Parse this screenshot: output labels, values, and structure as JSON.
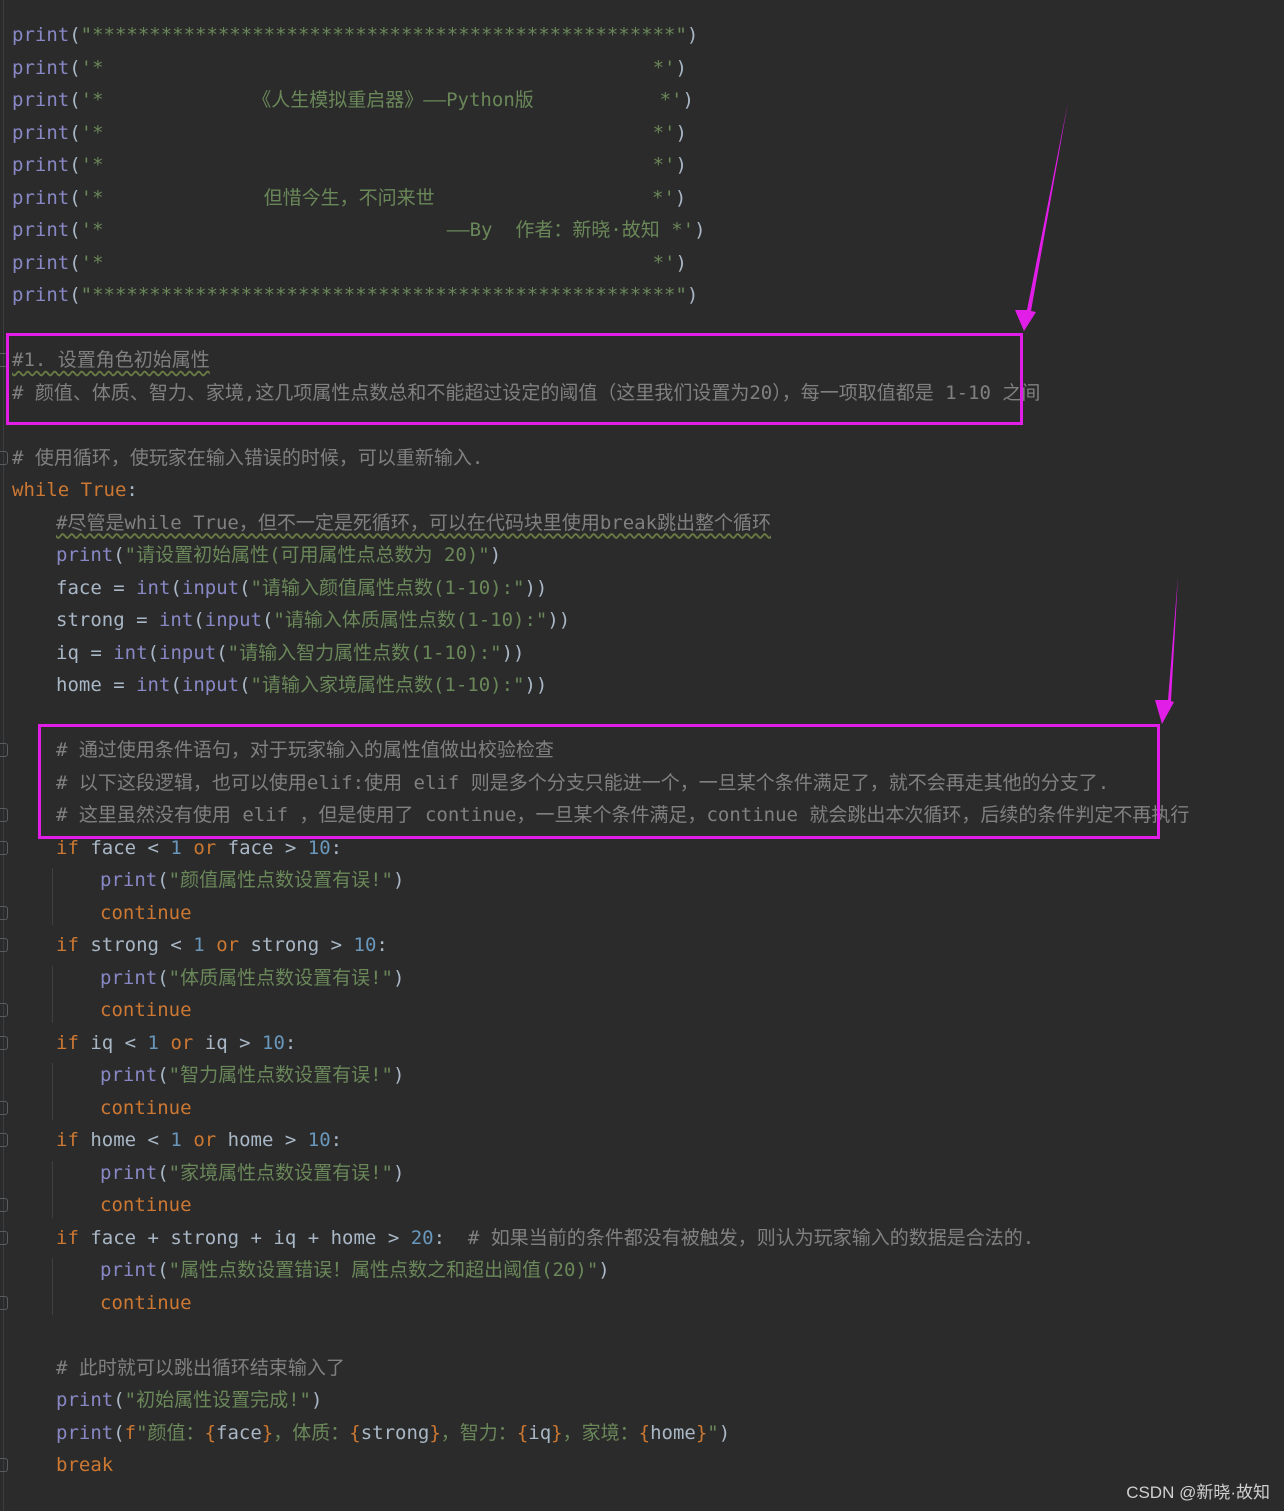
{
  "editor": {
    "lines": [
      {
        "indent": 0,
        "tokens": [
          {
            "t": "fn",
            "v": "print"
          },
          {
            "t": "op",
            "v": "("
          },
          {
            "t": "str",
            "v": "\"***************************************************\""
          },
          {
            "t": "op",
            "v": ")"
          }
        ]
      },
      {
        "indent": 0,
        "tokens": [
          {
            "t": "fn",
            "v": "print"
          },
          {
            "t": "op",
            "v": "("
          },
          {
            "t": "str",
            "v": "'*                                                *'"
          },
          {
            "t": "op",
            "v": ")"
          }
        ]
      },
      {
        "indent": 0,
        "tokens": [
          {
            "t": "fn",
            "v": "print"
          },
          {
            "t": "op",
            "v": "("
          },
          {
            "t": "str",
            "v": "'*             《人生模拟重启器》——Python版           *'"
          },
          {
            "t": "op",
            "v": ")"
          }
        ]
      },
      {
        "indent": 0,
        "tokens": [
          {
            "t": "fn",
            "v": "print"
          },
          {
            "t": "op",
            "v": "("
          },
          {
            "t": "str",
            "v": "'*                                                *'"
          },
          {
            "t": "op",
            "v": ")"
          }
        ]
      },
      {
        "indent": 0,
        "tokens": [
          {
            "t": "fn",
            "v": "print"
          },
          {
            "t": "op",
            "v": "("
          },
          {
            "t": "str",
            "v": "'*                                                *'"
          },
          {
            "t": "op",
            "v": ")"
          }
        ]
      },
      {
        "indent": 0,
        "tokens": [
          {
            "t": "fn",
            "v": "print"
          },
          {
            "t": "op",
            "v": "("
          },
          {
            "t": "str",
            "v": "'*              但惜今生，不问来世                   *'"
          },
          {
            "t": "op",
            "v": ")"
          }
        ]
      },
      {
        "indent": 0,
        "tokens": [
          {
            "t": "fn",
            "v": "print"
          },
          {
            "t": "op",
            "v": "("
          },
          {
            "t": "str",
            "v": "'*                              ——By  作者：新晓·故知 *'"
          },
          {
            "t": "op",
            "v": ")"
          }
        ]
      },
      {
        "indent": 0,
        "tokens": [
          {
            "t": "fn",
            "v": "print"
          },
          {
            "t": "op",
            "v": "("
          },
          {
            "t": "str",
            "v": "'*                                                *'"
          },
          {
            "t": "op",
            "v": ")"
          }
        ]
      },
      {
        "indent": 0,
        "tokens": [
          {
            "t": "fn",
            "v": "print"
          },
          {
            "t": "op",
            "v": "("
          },
          {
            "t": "str",
            "v": "\"***************************************************\""
          },
          {
            "t": "op",
            "v": ")"
          }
        ]
      },
      {
        "indent": 0,
        "tokens": []
      },
      {
        "indent": 0,
        "tokens": [
          {
            "t": "cm",
            "v": "#1. 设置角色初始属性",
            "wavy": true
          }
        ]
      },
      {
        "indent": 0,
        "tokens": [
          {
            "t": "cm",
            "v": "# 颜值、体质、智力、家境,这几项属性点数总和不能超过设定的阈值（这里我们设置为20），每一项取值都是 1-10 之间"
          }
        ]
      },
      {
        "indent": 0,
        "tokens": []
      },
      {
        "indent": 0,
        "tokens": [
          {
            "t": "cm",
            "v": "# 使用循环，使玩家在输入错误的时候，可以重新输入."
          }
        ]
      },
      {
        "indent": 0,
        "tokens": [
          {
            "t": "kw",
            "v": "while"
          },
          {
            "t": "op",
            "v": " "
          },
          {
            "t": "kw",
            "v": "True"
          },
          {
            "t": "op",
            "v": ":"
          }
        ]
      },
      {
        "indent": 1,
        "tokens": [
          {
            "t": "cm",
            "v": "#尽管是while True，但不一定是死循环，可以在代码块里使用break跳出整个循环",
            "wavy": true
          }
        ]
      },
      {
        "indent": 1,
        "tokens": [
          {
            "t": "fn",
            "v": "print"
          },
          {
            "t": "op",
            "v": "("
          },
          {
            "t": "str",
            "v": "\"请设置初始属性(可用属性点总数为 20)\""
          },
          {
            "t": "op",
            "v": ")"
          }
        ]
      },
      {
        "indent": 1,
        "tokens": [
          {
            "t": "id",
            "v": "face"
          },
          {
            "t": "op",
            "v": " = "
          },
          {
            "t": "fn",
            "v": "int"
          },
          {
            "t": "op",
            "v": "("
          },
          {
            "t": "fn",
            "v": "input"
          },
          {
            "t": "op",
            "v": "("
          },
          {
            "t": "str",
            "v": "\"请输入颜值属性点数(1-10):\""
          },
          {
            "t": "op",
            "v": "))"
          }
        ]
      },
      {
        "indent": 1,
        "tokens": [
          {
            "t": "id",
            "v": "strong"
          },
          {
            "t": "op",
            "v": " = "
          },
          {
            "t": "fn",
            "v": "int"
          },
          {
            "t": "op",
            "v": "("
          },
          {
            "t": "fn",
            "v": "input"
          },
          {
            "t": "op",
            "v": "("
          },
          {
            "t": "str",
            "v": "\"请输入体质属性点数(1-10):\""
          },
          {
            "t": "op",
            "v": "))"
          }
        ]
      },
      {
        "indent": 1,
        "tokens": [
          {
            "t": "id",
            "v": "iq"
          },
          {
            "t": "op",
            "v": " = "
          },
          {
            "t": "fn",
            "v": "int"
          },
          {
            "t": "op",
            "v": "("
          },
          {
            "t": "fn",
            "v": "input"
          },
          {
            "t": "op",
            "v": "("
          },
          {
            "t": "str",
            "v": "\"请输入智力属性点数(1-10):\""
          },
          {
            "t": "op",
            "v": "))"
          }
        ]
      },
      {
        "indent": 1,
        "tokens": [
          {
            "t": "id",
            "v": "home"
          },
          {
            "t": "op",
            "v": " = "
          },
          {
            "t": "fn",
            "v": "int"
          },
          {
            "t": "op",
            "v": "("
          },
          {
            "t": "fn",
            "v": "input"
          },
          {
            "t": "op",
            "v": "("
          },
          {
            "t": "str",
            "v": "\"请输入家境属性点数(1-10):\""
          },
          {
            "t": "op",
            "v": "))"
          }
        ]
      },
      {
        "indent": 0,
        "tokens": []
      },
      {
        "indent": 1,
        "tokens": [
          {
            "t": "cm",
            "v": "# 通过使用条件语句，对于玩家输入的属性值做出校验检查"
          }
        ]
      },
      {
        "indent": 1,
        "tokens": [
          {
            "t": "cm",
            "v": "# 以下这段逻辑，也可以使用elif:使用 elif 则是多个分支只能进一个，一旦某个条件满足了，就不会再走其他的分支了."
          }
        ]
      },
      {
        "indent": 1,
        "tokens": [
          {
            "t": "cm",
            "v": "# 这里虽然没有使用 elif ，但是使用了 continue，一旦某个条件满足，continue 就会跳出本次循环，后续的条件判定不再执行"
          }
        ]
      },
      {
        "indent": 1,
        "tokens": [
          {
            "t": "kw",
            "v": "if"
          },
          {
            "t": "id",
            "v": " face "
          },
          {
            "t": "op",
            "v": "< "
          },
          {
            "t": "num",
            "v": "1"
          },
          {
            "t": "op",
            "v": " "
          },
          {
            "t": "kw",
            "v": "or"
          },
          {
            "t": "id",
            "v": " face "
          },
          {
            "t": "op",
            "v": "> "
          },
          {
            "t": "num",
            "v": "10"
          },
          {
            "t": "op",
            "v": ":"
          }
        ]
      },
      {
        "indent": 2,
        "tokens": [
          {
            "t": "fn",
            "v": "print"
          },
          {
            "t": "op",
            "v": "("
          },
          {
            "t": "str",
            "v": "\"颜值属性点数设置有误!\""
          },
          {
            "t": "op",
            "v": ")"
          }
        ]
      },
      {
        "indent": 2,
        "tokens": [
          {
            "t": "kw",
            "v": "continue"
          }
        ]
      },
      {
        "indent": 1,
        "tokens": [
          {
            "t": "kw",
            "v": "if"
          },
          {
            "t": "id",
            "v": " strong "
          },
          {
            "t": "op",
            "v": "< "
          },
          {
            "t": "num",
            "v": "1"
          },
          {
            "t": "op",
            "v": " "
          },
          {
            "t": "kw",
            "v": "or"
          },
          {
            "t": "id",
            "v": " strong "
          },
          {
            "t": "op",
            "v": "> "
          },
          {
            "t": "num",
            "v": "10"
          },
          {
            "t": "op",
            "v": ":"
          }
        ]
      },
      {
        "indent": 2,
        "tokens": [
          {
            "t": "fn",
            "v": "print"
          },
          {
            "t": "op",
            "v": "("
          },
          {
            "t": "str",
            "v": "\"体质属性点数设置有误!\""
          },
          {
            "t": "op",
            "v": ")"
          }
        ]
      },
      {
        "indent": 2,
        "tokens": [
          {
            "t": "kw",
            "v": "continue"
          }
        ]
      },
      {
        "indent": 1,
        "tokens": [
          {
            "t": "kw",
            "v": "if"
          },
          {
            "t": "id",
            "v": " iq "
          },
          {
            "t": "op",
            "v": "< "
          },
          {
            "t": "num",
            "v": "1"
          },
          {
            "t": "op",
            "v": " "
          },
          {
            "t": "kw",
            "v": "or"
          },
          {
            "t": "id",
            "v": " iq "
          },
          {
            "t": "op",
            "v": "> "
          },
          {
            "t": "num",
            "v": "10"
          },
          {
            "t": "op",
            "v": ":"
          }
        ]
      },
      {
        "indent": 2,
        "tokens": [
          {
            "t": "fn",
            "v": "print"
          },
          {
            "t": "op",
            "v": "("
          },
          {
            "t": "str",
            "v": "\"智力属性点数设置有误!\""
          },
          {
            "t": "op",
            "v": ")"
          }
        ]
      },
      {
        "indent": 2,
        "tokens": [
          {
            "t": "kw",
            "v": "continue"
          }
        ]
      },
      {
        "indent": 1,
        "tokens": [
          {
            "t": "kw",
            "v": "if"
          },
          {
            "t": "id",
            "v": " home "
          },
          {
            "t": "op",
            "v": "< "
          },
          {
            "t": "num",
            "v": "1"
          },
          {
            "t": "op",
            "v": " "
          },
          {
            "t": "kw",
            "v": "or"
          },
          {
            "t": "id",
            "v": " home "
          },
          {
            "t": "op",
            "v": "> "
          },
          {
            "t": "num",
            "v": "10"
          },
          {
            "t": "op",
            "v": ":"
          }
        ]
      },
      {
        "indent": 2,
        "tokens": [
          {
            "t": "fn",
            "v": "print"
          },
          {
            "t": "op",
            "v": "("
          },
          {
            "t": "str",
            "v": "\"家境属性点数设置有误!\""
          },
          {
            "t": "op",
            "v": ")"
          }
        ]
      },
      {
        "indent": 2,
        "tokens": [
          {
            "t": "kw",
            "v": "continue"
          }
        ]
      },
      {
        "indent": 1,
        "tokens": [
          {
            "t": "kw",
            "v": "if"
          },
          {
            "t": "id",
            "v": " face "
          },
          {
            "t": "op",
            "v": "+ "
          },
          {
            "t": "id",
            "v": "strong "
          },
          {
            "t": "op",
            "v": "+ "
          },
          {
            "t": "id",
            "v": "iq "
          },
          {
            "t": "op",
            "v": "+ "
          },
          {
            "t": "id",
            "v": "home "
          },
          {
            "t": "op",
            "v": "> "
          },
          {
            "t": "num",
            "v": "20"
          },
          {
            "t": "op",
            "v": ":  "
          },
          {
            "t": "cm",
            "v": "# 如果当前的条件都没有被触发，则认为玩家输入的数据是合法的."
          }
        ]
      },
      {
        "indent": 2,
        "tokens": [
          {
            "t": "fn",
            "v": "print"
          },
          {
            "t": "op",
            "v": "("
          },
          {
            "t": "str",
            "v": "\"属性点数设置错误！属性点数之和超出阈值(20)\""
          },
          {
            "t": "op",
            "v": ")"
          }
        ]
      },
      {
        "indent": 2,
        "tokens": [
          {
            "t": "kw",
            "v": "continue"
          }
        ]
      },
      {
        "indent": 0,
        "tokens": []
      },
      {
        "indent": 1,
        "tokens": [
          {
            "t": "cm",
            "v": "# 此时就可以跳出循环结束输入了"
          }
        ]
      },
      {
        "indent": 1,
        "tokens": [
          {
            "t": "fn",
            "v": "print"
          },
          {
            "t": "op",
            "v": "("
          },
          {
            "t": "str",
            "v": "\"初始属性设置完成!\""
          },
          {
            "t": "op",
            "v": ")"
          }
        ]
      },
      {
        "indent": 1,
        "tokens": [
          {
            "t": "fn",
            "v": "print"
          },
          {
            "t": "op",
            "v": "("
          },
          {
            "t": "kw",
            "v": "f"
          },
          {
            "t": "str",
            "v": "\"颜值："
          },
          {
            "t": "brace",
            "v": "{"
          },
          {
            "t": "id",
            "v": "face"
          },
          {
            "t": "brace",
            "v": "}"
          },
          {
            "t": "str",
            "v": "，体质："
          },
          {
            "t": "brace",
            "v": "{"
          },
          {
            "t": "id",
            "v": "strong"
          },
          {
            "t": "brace",
            "v": "}"
          },
          {
            "t": "str",
            "v": "，智力："
          },
          {
            "t": "brace",
            "v": "{"
          },
          {
            "t": "id",
            "v": "iq"
          },
          {
            "t": "brace",
            "v": "}"
          },
          {
            "t": "str",
            "v": "，家境："
          },
          {
            "t": "brace",
            "v": "{"
          },
          {
            "t": "id",
            "v": "home"
          },
          {
            "t": "brace",
            "v": "}"
          },
          {
            "t": "str",
            "v": "\""
          },
          {
            "t": "op",
            "v": ")"
          }
        ]
      },
      {
        "indent": 1,
        "tokens": [
          {
            "t": "kw",
            "v": "break"
          }
        ]
      }
    ]
  },
  "colors": {
    "background": "#2b2b2b",
    "highlight": "#e11ee8",
    "function": "#8888c6",
    "string": "#6a8759",
    "comment": "#808080",
    "keyword": "#cc7832",
    "number": "#6897bb",
    "text": "#a9b7c6"
  },
  "watermark": "CSDN @新晓·故知"
}
